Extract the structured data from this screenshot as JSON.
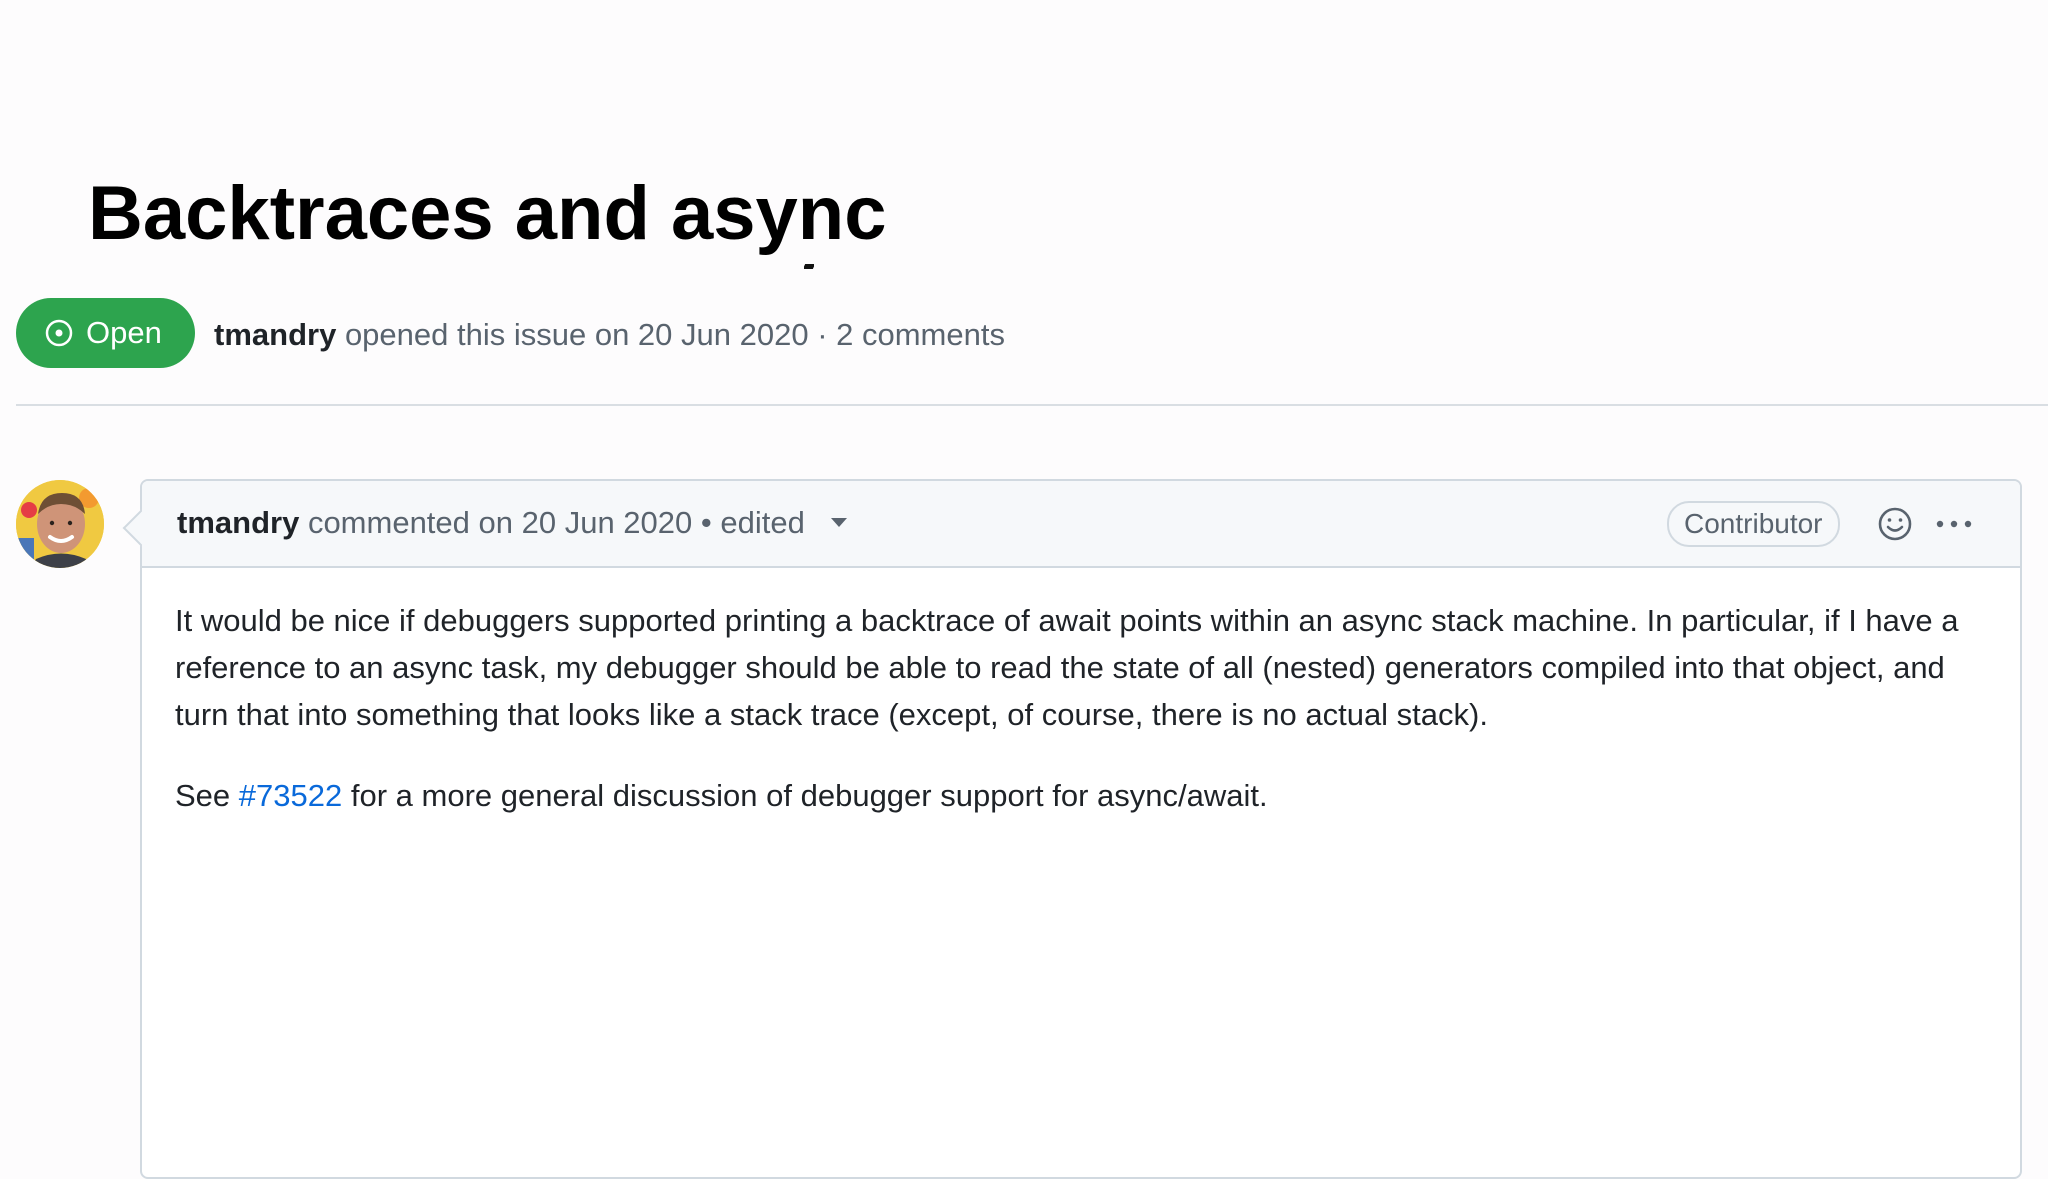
{
  "slide": {
    "title": "Backtraces and async"
  },
  "issue": {
    "status": "Open",
    "status_color": "#2da44e",
    "author": "tmandry",
    "opened_text": "opened this issue on 20 Jun 2020 · 2 comments"
  },
  "comment": {
    "author": "tmandry",
    "commented_text": "commented on 20 Jun 2020",
    "separator": "•",
    "edited_label": "edited",
    "role_badge": "Contributor",
    "body": {
      "paragraph_1": "It would be nice if debuggers supported printing a backtrace of await points within an async stack machine. In particular, if I have a reference to an async task, my debugger should be able to read the state of all (nested) generators compiled into that object, and turn that into something that looks like a stack trace (except, of course, there is no actual stack).",
      "paragraph_2_prefix": "See",
      "issue_link": "#73522",
      "paragraph_2_suffix": "for a more general discussion of debugger support for async/await."
    }
  },
  "icons": {
    "status": "issue-opened-icon",
    "reaction": "smiley-icon",
    "menu": "kebab-horizontal-icon",
    "edited_dropdown": "triangle-down-icon"
  },
  "colors": {
    "link": "#0969da",
    "muted_text": "#59636e",
    "border": "#d1d9e0"
  }
}
